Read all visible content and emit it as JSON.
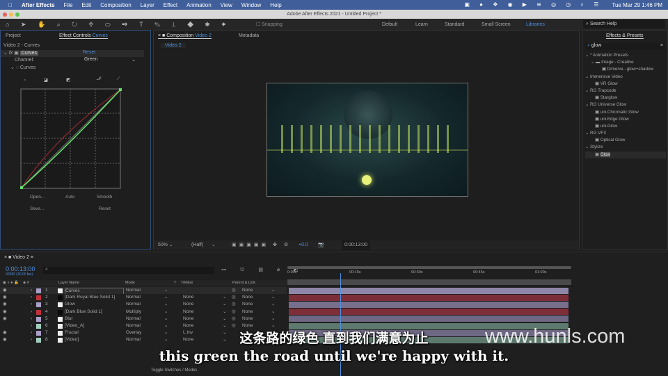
{
  "menubar": {
    "app": "After Effects",
    "items": [
      "File",
      "Edit",
      "Composition",
      "Layer",
      "Effect",
      "Animation",
      "View",
      "Window",
      "Help"
    ],
    "clock": "Tue Mar 29  1:46 PM"
  },
  "window": {
    "title": "Adobe After Effects 2021 - Untitled Project *"
  },
  "toolbar": {
    "snapping": "Snapping",
    "workspaces": [
      "Default",
      "Learn",
      "Standard",
      "Small Screen",
      "Libraries"
    ],
    "search_placeholder": "Search Help"
  },
  "left_panel": {
    "tab_project": "Project",
    "tab_effect_controls": "Effect Controls",
    "tab_effect_target": "Curves",
    "layer_path": "Video 2 - Curves",
    "effect_name": "Curves",
    "reset": "Reset",
    "channel_label": "Channel:",
    "channel_value": "Green",
    "curves_label": "Curves",
    "buttons": {
      "open": "Open...",
      "auto": "Auto",
      "smooth": "Smooth",
      "save": "Save...",
      "reset": "Reset"
    }
  },
  "comp_panel": {
    "tab_label": "Composition",
    "tab_target": "Video 2",
    "tab_metadata": "Metadata",
    "breadcrumb": "Video 2",
    "zoom": "50%",
    "resolution": "(Half)",
    "exposure": "+0.0",
    "timecode": "0:00:13:00"
  },
  "effects_panel": {
    "tab": "Effects & Presets",
    "search": "glow",
    "tree": [
      {
        "label": "* Animation Presets",
        "level": 0
      },
      {
        "label": "Image - Creative",
        "level": 1
      },
      {
        "label": "Dimensi...glow+shadow",
        "level": 2
      },
      {
        "label": "Immersive Video",
        "level": 0
      },
      {
        "label": "VR Glow",
        "level": 1
      },
      {
        "label": "RG Trapcode",
        "level": 0
      },
      {
        "label": "Starglow",
        "level": 1
      },
      {
        "label": "RG Universe Glow",
        "level": 0
      },
      {
        "label": "uni.Chromatic Glow",
        "level": 1
      },
      {
        "label": "uni.Edge Glow",
        "level": 1
      },
      {
        "label": "uni.Glow",
        "level": 1
      },
      {
        "label": "RG VFX",
        "level": 0
      },
      {
        "label": "Optical Glow",
        "level": 1
      },
      {
        "label": "Stylize",
        "level": 0
      },
      {
        "label": "Glow",
        "level": 1,
        "selected": true
      }
    ]
  },
  "timeline": {
    "tab": "Video 2",
    "timecode": "0:00:13:00",
    "fps": "00390 (30.00 fps)",
    "columns": {
      "name": "Layer Name",
      "mode": "Mode",
      "t": "T",
      "trkmat": "TrkMat",
      "parent": "Parent & Link"
    },
    "ruler": [
      "0:00s",
      "00:15s",
      "00:30s",
      "00:45s",
      "01:00s"
    ],
    "layers": [
      {
        "num": "1",
        "name": "Curves",
        "label": "#a99fc8",
        "mode": "Normal",
        "trkmat": "",
        "parent": "None",
        "bar": "#8f87a8"
      },
      {
        "num": "2",
        "name": "[Dark Royal Blue Solid 1]",
        "label": "#c0303a",
        "mode": "Normal",
        "trkmat": "None",
        "parent": "None",
        "bar": "#7e2e38"
      },
      {
        "num": "3",
        "name": "Glow",
        "label": "#a99fc8",
        "mode": "Normal",
        "trkmat": "None",
        "parent": "None",
        "bar": "#776f8c"
      },
      {
        "num": "4",
        "name": "[Dark Blue Solid 1]",
        "label": "#c0303a",
        "mode": "Multiply",
        "trkmat": "None",
        "parent": "None",
        "bar": "#7e2e38"
      },
      {
        "num": "5",
        "name": "Blur",
        "label": "#a99fc8",
        "mode": "Normal",
        "trkmat": "None",
        "parent": "None",
        "bar": "#6f6884"
      },
      {
        "num": "6",
        "name": "[Video_A]",
        "label": "#9fcfbf",
        "mode": "Normal",
        "trkmat": "None",
        "parent": "None",
        "bar": "#5e7a6e"
      },
      {
        "num": "7",
        "name": "Fractal",
        "label": "#a99fc8",
        "mode": "Overlay",
        "trkmat": "L.Inv",
        "parent": "",
        "bar": "#6f6884"
      },
      {
        "num": "8",
        "name": "[Video]",
        "label": "#9fcfbf",
        "mode": "Normal",
        "trkmat": "None",
        "parent": "",
        "bar": "#5e7a6e"
      }
    ],
    "toggle": "Toggle Switches / Modes"
  },
  "subtitles": {
    "zh": "这条路的绿色 直到我们满意为止",
    "en": "this green the road until we're happy with it."
  },
  "watermark": "www.hunls.com"
}
